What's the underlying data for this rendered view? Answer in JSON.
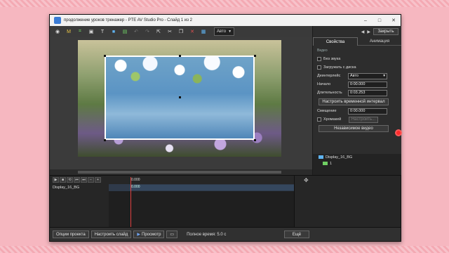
{
  "window": {
    "title": "продолжение уроков тренажер - PTE AV Studio Pro - Слайд 1 из 2",
    "controls": [
      "–",
      "□",
      "✕"
    ],
    "accent": "#3a7bd5"
  },
  "toolbar": {
    "icons": [
      "camera-icon",
      "text-m-icon",
      "crop-icon",
      "image-icon",
      "text-t-icon",
      "rectangle-icon",
      "picture-icon",
      "undo-icon",
      "redo-icon",
      "select-icon",
      "cut-icon",
      "copy-icon",
      "delete-icon",
      "grid-icon"
    ],
    "zoom_select": "Авто"
  },
  "right_panel": {
    "close_label": "Закрыть",
    "tabs": [
      "Свойства",
      "Анимация"
    ],
    "section": "Видео",
    "mute_label": "Без звука",
    "load_from_disk_label": "Загружать с диска",
    "deinterlace_label": "Деинтерлейс",
    "deinterlace_value": "Авто",
    "start_label": "Начало",
    "start_value": "0:00.000",
    "duration_label": "Длительность",
    "duration_value": "0:03.253",
    "set_interval_label": "Настроить временной интервал",
    "offset_label": "Смещение",
    "offset_value": "0:00.000",
    "chromakey_label": "Хромакей",
    "chromakey_settings_label": "Настроить...",
    "independent_video_label": "Независимое видео"
  },
  "objects": {
    "item1": "Display_16_BG",
    "item2": "1"
  },
  "timeline": {
    "time_label": "0.000",
    "clip_time": "0.000",
    "track_name": "Display_16_BG"
  },
  "statusbar": {
    "project_options": "Опции проекта",
    "slide_options": "Настроить слайд",
    "preview": "Просмотр",
    "total_time": "Полное время: 5.0 с",
    "more": "Ещё"
  }
}
